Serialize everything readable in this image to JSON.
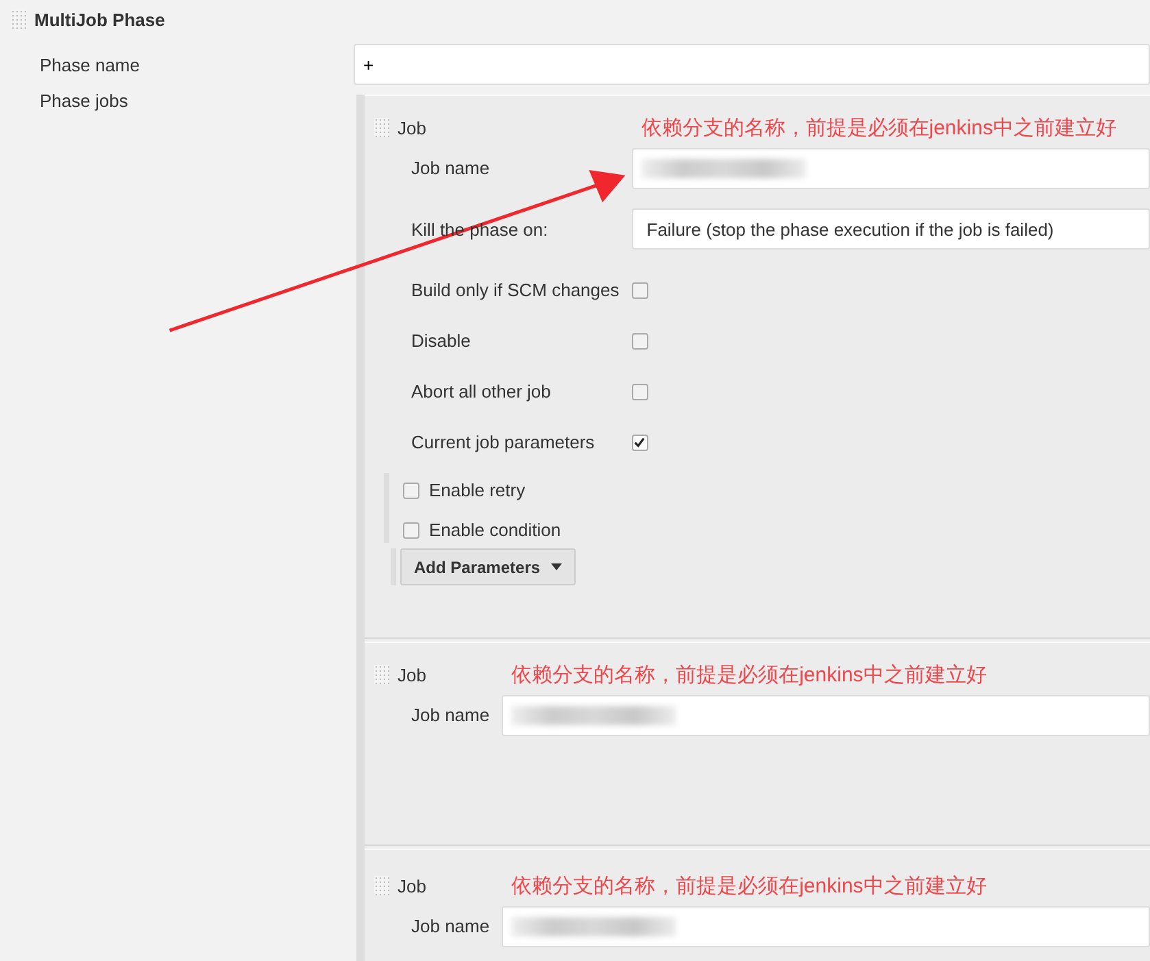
{
  "section": {
    "title": "MultiJob Phase"
  },
  "phase_name": {
    "label": "Phase name",
    "value": "+"
  },
  "phase_jobs": {
    "label": "Phase jobs"
  },
  "jobs": [
    {
      "header": "Job",
      "note": "依赖分支的名称，前提是必须在jenkins中之前建立好",
      "fields": [
        {
          "kind": "text",
          "label": "Job name"
        },
        {
          "kind": "select",
          "label": "Kill the phase on:",
          "value": "Failure (stop the phase execution if the job is failed)"
        },
        {
          "kind": "checkbox",
          "label": "Build only if SCM changes",
          "checked": false
        },
        {
          "kind": "checkbox",
          "label": "Disable",
          "checked": false
        },
        {
          "kind": "checkbox",
          "label": "Abort all other job",
          "checked": false
        },
        {
          "kind": "checkbox",
          "label": "Current job parameters",
          "checked": true
        }
      ],
      "options": [
        {
          "label": "Enable retry",
          "checked": false
        },
        {
          "label": "Enable condition",
          "checked": false
        }
      ],
      "button": "Add Parameters"
    },
    {
      "header": "Job",
      "note": "依赖分支的名称，前提是必须在jenkins中之前建立好",
      "fields": [
        {
          "kind": "text",
          "label": "Job name"
        }
      ]
    },
    {
      "header": "Job",
      "note": "依赖分支的名称，前提是必须在jenkins中之前建立好",
      "fields": [
        {
          "kind": "text",
          "label": "Job name"
        }
      ]
    }
  ]
}
